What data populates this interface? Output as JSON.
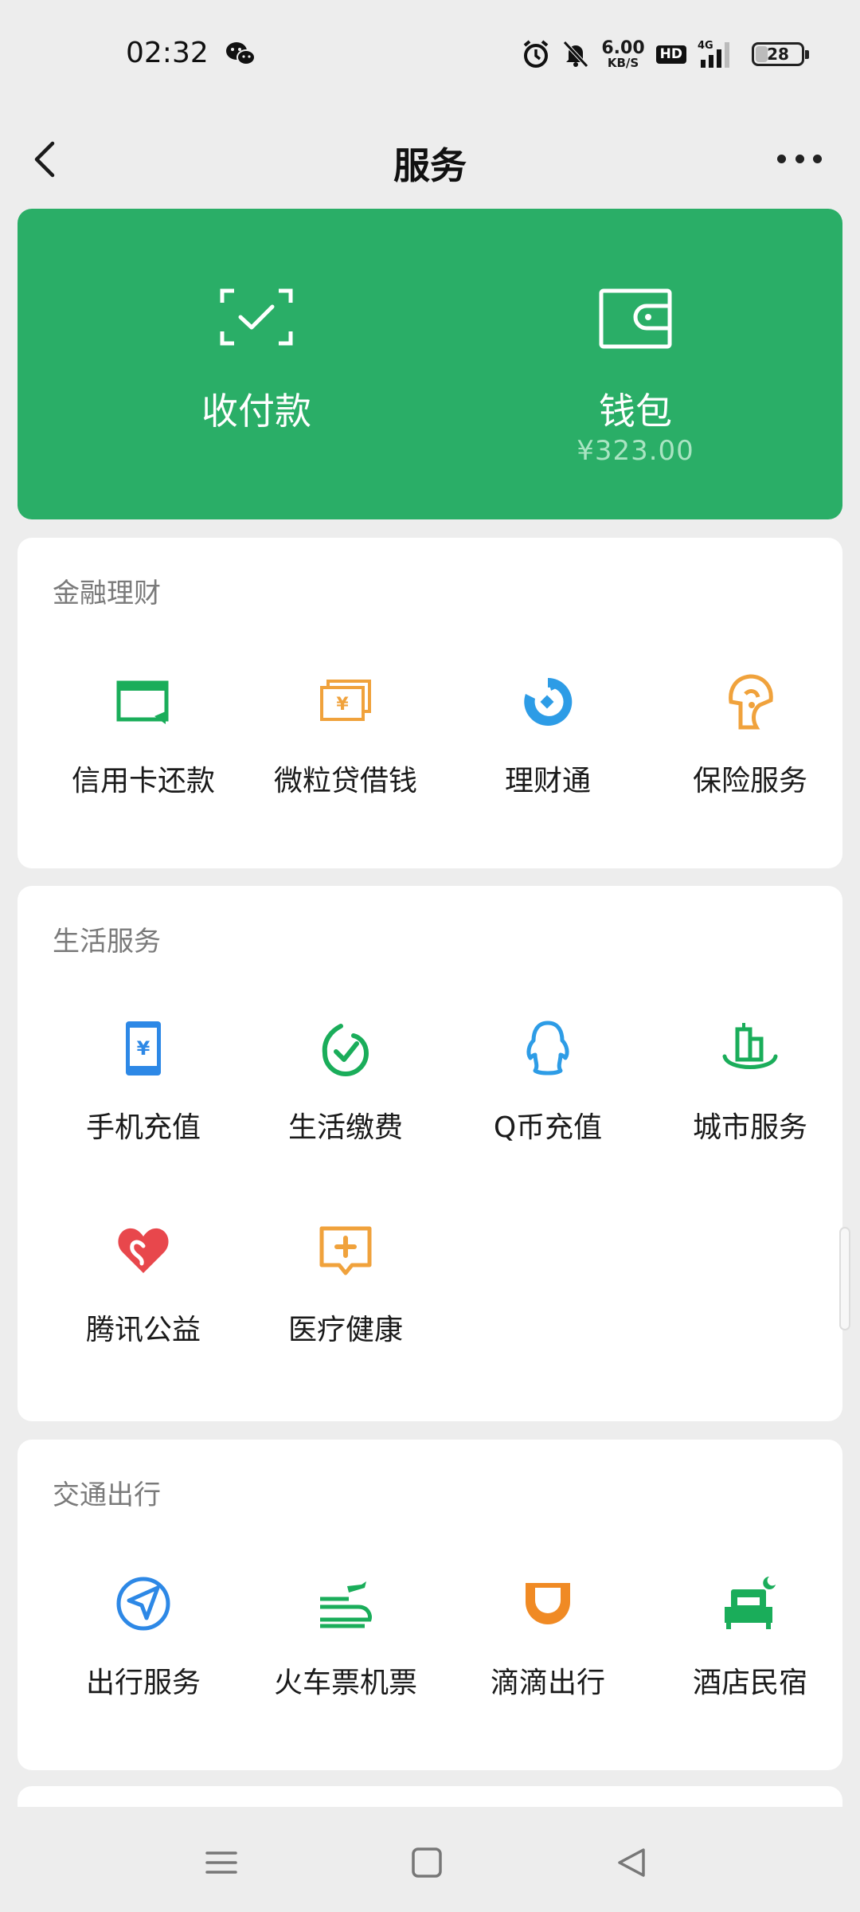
{
  "status": {
    "time": "02:32",
    "speed_value": "6.00",
    "speed_unit": "KB/S",
    "hd": "HD",
    "network": "4G",
    "battery": "28"
  },
  "header": {
    "title": "服务"
  },
  "pay_card": {
    "left_label": "收付款",
    "right_label": "钱包",
    "balance": "¥323.00",
    "bg_color": "#2aae67"
  },
  "sections": {
    "finance": {
      "title": "金融理财",
      "items": [
        {
          "label": "信用卡还款",
          "icon": "credit-card-icon",
          "color": "#1aad5a"
        },
        {
          "label": "微粒贷借钱",
          "icon": "loan-icon",
          "color": "#f0a23c"
        },
        {
          "label": "理财通",
          "icon": "wealth-icon",
          "color": "#2d9ce6"
        },
        {
          "label": "保险服务",
          "icon": "insurance-icon",
          "color": "#f0a23c"
        }
      ]
    },
    "life": {
      "title": "生活服务",
      "items": [
        {
          "label": "手机充值",
          "icon": "phone-recharge-icon",
          "color": "#2d88e6"
        },
        {
          "label": "生活缴费",
          "icon": "utility-payment-icon",
          "color": "#1aad5a"
        },
        {
          "label": "Q币充值",
          "icon": "qq-coin-icon",
          "color": "#2d9ce6"
        },
        {
          "label": "城市服务",
          "icon": "city-service-icon",
          "color": "#1aad5a"
        },
        {
          "label": "腾讯公益",
          "icon": "charity-heart-icon",
          "color": "#e8474c"
        },
        {
          "label": "医疗健康",
          "icon": "medical-icon",
          "color": "#f0a23c"
        }
      ]
    },
    "travel": {
      "title": "交通出行",
      "items": [
        {
          "label": "出行服务",
          "icon": "travel-navigation-icon",
          "color": "#2d88e6"
        },
        {
          "label": "火车票机票",
          "icon": "train-plane-icon",
          "color": "#1aad5a"
        },
        {
          "label": "滴滴出行",
          "icon": "didi-icon",
          "color": "#f08a24"
        },
        {
          "label": "酒店民宿",
          "icon": "hotel-bed-icon",
          "color": "#1aad5a"
        }
      ]
    }
  }
}
